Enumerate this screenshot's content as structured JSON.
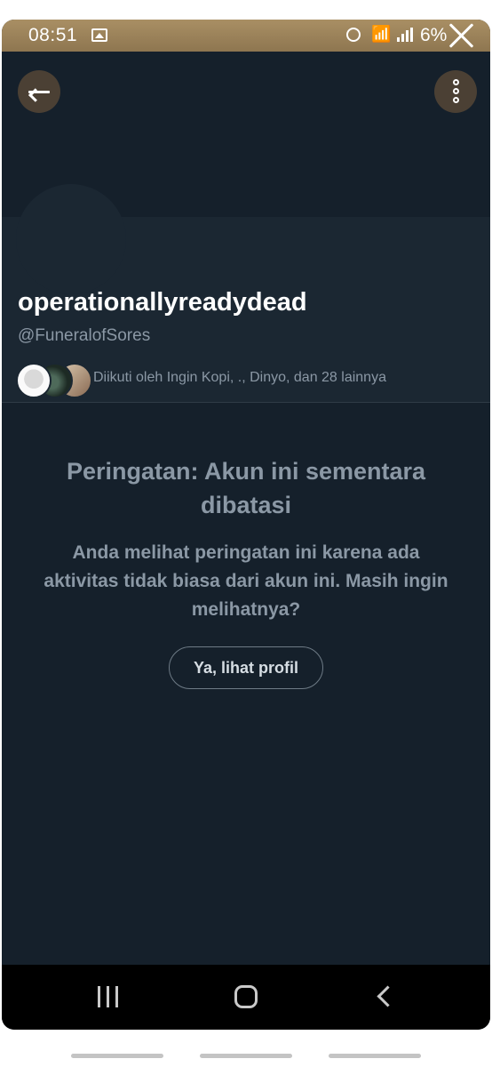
{
  "status_bar": {
    "time": "08:51",
    "battery": "6%",
    "icons": [
      "gallery-icon",
      "alarm-icon",
      "wifi-icon",
      "signal-icon",
      "close-icon"
    ]
  },
  "header": {
    "back_icon": "arrow-left-icon",
    "more_icon": "more-vertical-icon"
  },
  "profile": {
    "display_name": "operationallyreadydead",
    "handle": "@FuneralofSores",
    "followed_by": "Diikuti oleh Ingin Kopi, ., Dinyo, dan 28 lainnya"
  },
  "warning": {
    "title": "Peringatan: Akun ini sementara dibatasi",
    "body": "Anda melihat peringatan ini karena ada aktivitas tidak biasa dari akun ini. Masih ingin melihatnya?",
    "button_label": "Ya, lihat profil"
  },
  "nav_bar": {
    "icons": [
      "recents-icon",
      "home-icon",
      "back-icon"
    ]
  },
  "colors": {
    "background": "#15202b",
    "profile_background": "#1b2732",
    "status_bar": "#9c8459",
    "muted_text": "#8b98a5"
  }
}
